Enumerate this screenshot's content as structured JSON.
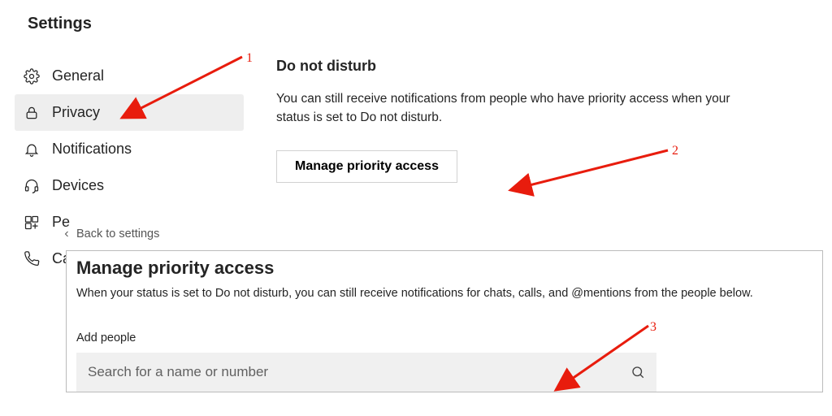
{
  "page_title": "Settings",
  "sidebar": {
    "items": [
      {
        "label": "General",
        "icon": "gear-icon",
        "selected": false
      },
      {
        "label": "Privacy",
        "icon": "lock-icon",
        "selected": true
      },
      {
        "label": "Notifications",
        "icon": "bell-icon",
        "selected": false
      },
      {
        "label": "Devices",
        "icon": "headset-icon",
        "selected": false
      },
      {
        "label": "Pe",
        "icon": "permissions-icon",
        "selected": false
      },
      {
        "label": "Ca",
        "icon": "phone-icon",
        "selected": false
      }
    ]
  },
  "content": {
    "dnd": {
      "title": "Do not disturb",
      "description": "You can still receive notifications from people who have priority access when your status is set to Do not disturb.",
      "button_label": "Manage priority access"
    }
  },
  "panel": {
    "back_label": "Back to settings",
    "title": "Manage priority access",
    "description": "When your status is set to Do not disturb, you can still receive notifications for chats, calls, and @mentions from the people below.",
    "add_people_label": "Add people",
    "search_placeholder": "Search for a name or number"
  },
  "annotations": {
    "n1": "1",
    "n2": "2",
    "n3": "3",
    "color": "#e81c0d"
  }
}
